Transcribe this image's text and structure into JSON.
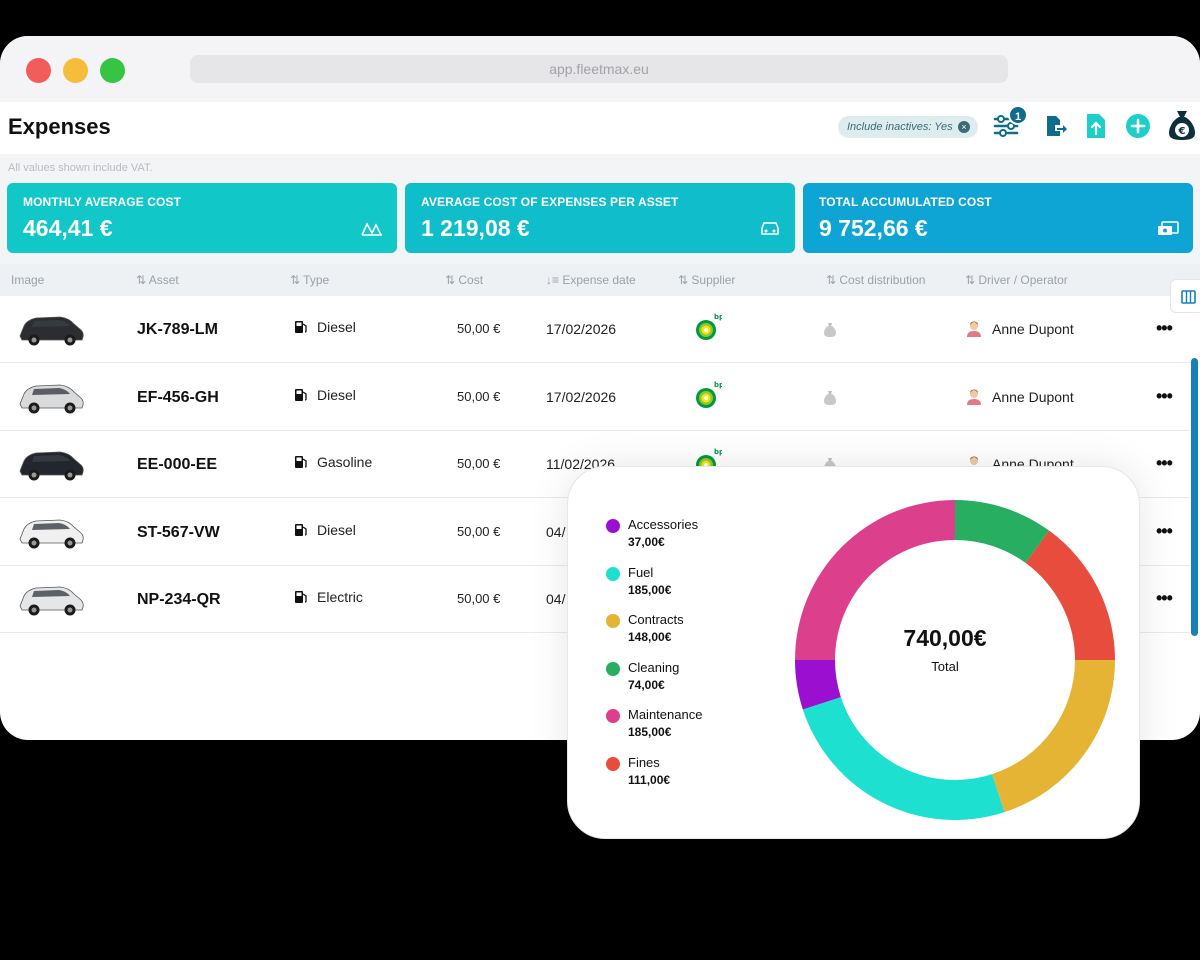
{
  "browser": {
    "url": "app.fleetmax.eu"
  },
  "header": {
    "title": "Expenses",
    "filter_chip": "Include inactives: Yes",
    "filter_badge": "1"
  },
  "vat_note": "All values shown include VAT.",
  "cards": [
    {
      "label": "MONTHLY AVERAGE COST",
      "value": "464,41 €",
      "icon": "chart-icon"
    },
    {
      "label": "AVERAGE COST OF EXPENSES PER ASSET",
      "value": "1 219,08 €",
      "icon": "car-icon"
    },
    {
      "label": "TOTAL ACCUMULATED COST",
      "value": "9 752,66 €",
      "icon": "cash-icon"
    }
  ],
  "table": {
    "columns": [
      "Image",
      "Asset",
      "Type",
      "Cost",
      "Expense date",
      "Supplier",
      "Cost distribution",
      "Driver / Operator"
    ],
    "rows": [
      {
        "asset": "JK-789-LM",
        "type": "Diesel",
        "cost": "50,00 €",
        "date": "17/02/2026",
        "driver": "Anne Dupont",
        "car_color": "#2b2d31"
      },
      {
        "asset": "EF-456-GH",
        "type": "Diesel",
        "cost": "50,00 €",
        "date": "17/02/2026",
        "driver": "Anne Dupont",
        "car_color": "#d9dadc"
      },
      {
        "asset": "EE-000-EE",
        "type": "Gasoline",
        "cost": "50,00 €",
        "date": "11/02/2026",
        "driver": "Anne Dupont",
        "car_color": "#23262c"
      },
      {
        "asset": "ST-567-VW",
        "type": "Diesel",
        "cost": "50,00 €",
        "date": "04/",
        "driver": "",
        "car_color": "#f0f0f0"
      },
      {
        "asset": "NP-234-QR",
        "type": "Electric",
        "cost": "50,00 €",
        "date": "04/",
        "driver": "",
        "car_color": "#e4e6e8"
      }
    ]
  },
  "breakdown": {
    "total": "740,00€",
    "total_label": "Total",
    "items": [
      {
        "name": "Accessories",
        "value": "37,00€",
        "color": "#9b0fd0"
      },
      {
        "name": "Fuel",
        "value": "185,00€",
        "color": "#1de0d0"
      },
      {
        "name": "Contracts",
        "value": "148,00€",
        "color": "#e5b435"
      },
      {
        "name": "Cleaning",
        "value": "74,00€",
        "color": "#27ae60"
      },
      {
        "name": "Maintenance",
        "value": "185,00€",
        "color": "#dc3f8b"
      },
      {
        "name": "Fines",
        "value": "111,00€",
        "color": "#e74c3c"
      }
    ]
  },
  "chart_data": {
    "type": "pie",
    "categories": [
      "Accessories",
      "Fuel",
      "Contracts",
      "Cleaning",
      "Maintenance",
      "Fines"
    ],
    "values": [
      37.0,
      185.0,
      148.0,
      74.0,
      185.0,
      111.0
    ],
    "colors": [
      "#9b0fd0",
      "#1de0d0",
      "#e5b435",
      "#27ae60",
      "#dc3f8b",
      "#e74c3c"
    ],
    "slice_order_clockwise_from_top": [
      "Cleaning",
      "Fines",
      "Contracts",
      "Fuel",
      "Accessories",
      "Maintenance"
    ],
    "legend": "left"
  }
}
